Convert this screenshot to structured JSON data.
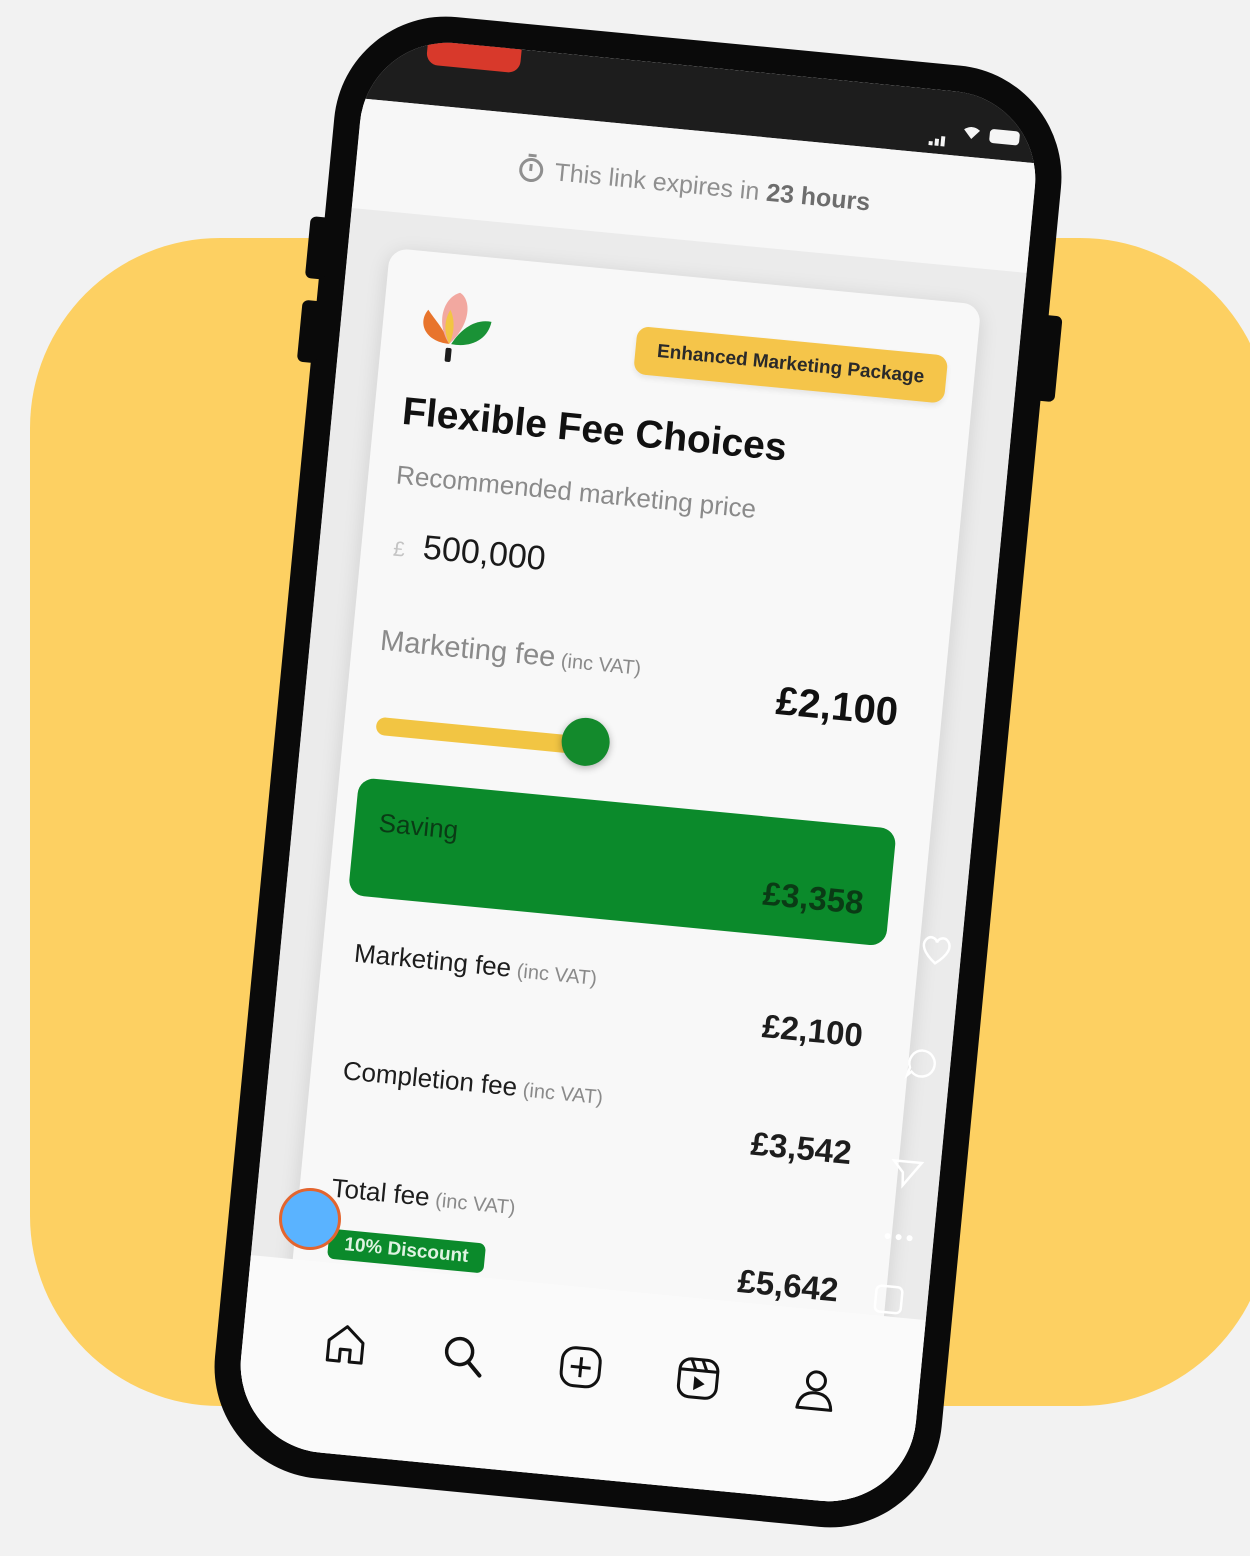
{
  "expiry": {
    "prefix": "This link expires in",
    "time": "23 hours"
  },
  "badge": "Enhanced Marketing Package",
  "title": "Flexible Fee Choices",
  "subtitle": "Recommended marketing price",
  "price": {
    "currency": "£",
    "value": "500,000"
  },
  "marketing_fee": {
    "label": "Marketing fee",
    "suffix": "(inc VAT)",
    "amount": "£2,100",
    "slider_fraction": 0.42
  },
  "saving": {
    "label": "Saving",
    "amount": "£3,358"
  },
  "rows": [
    {
      "label": "Marketing fee",
      "suffix": "(inc VAT)",
      "amount": "£2,100"
    },
    {
      "label": "Completion fee",
      "suffix": "(inc VAT)",
      "amount": "£3,542"
    },
    {
      "label": "Total fee",
      "suffix": "(inc VAT)",
      "amount": "£5,642",
      "badge": "10% Discount"
    }
  ],
  "colors": {
    "background_blob": "#fdd062",
    "brand_green": "#0b8a2b",
    "badge_yellow": "#f5c54a",
    "slider_track": "#f2c543"
  },
  "nav": [
    {
      "icon": "home-icon"
    },
    {
      "icon": "search-icon"
    },
    {
      "icon": "create-icon"
    },
    {
      "icon": "reels-icon"
    },
    {
      "icon": "profile-icon"
    }
  ]
}
